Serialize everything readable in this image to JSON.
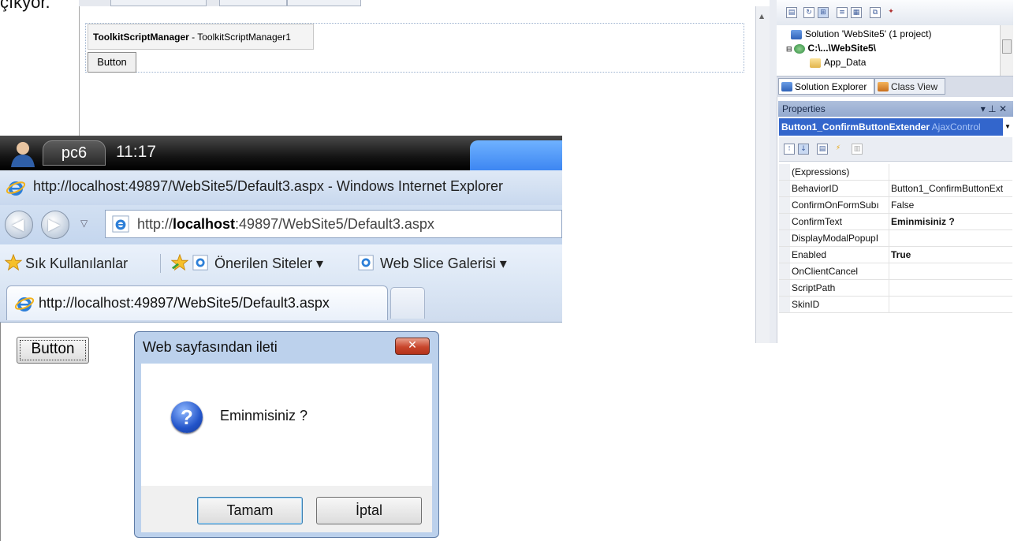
{
  "caption": "çıkyor.",
  "designer": {
    "toolkit_box_bold": "ToolkitScriptManager",
    "toolkit_box_rest": " - ToolkitScriptManager1",
    "button_label": "Button"
  },
  "solution_explorer": {
    "tree": [
      {
        "label": "Solution 'WebSite5' (1 project)"
      },
      {
        "label": "C:\\...\\WebSite5\\"
      },
      {
        "label": "App_Data"
      }
    ],
    "tabs": [
      {
        "label": "Solution Explorer"
      },
      {
        "label": "Class View"
      }
    ]
  },
  "properties": {
    "title": "Properties",
    "controls": "▾ ⊥ ✕",
    "selected_object": "Button1_ConfirmButtonExtender",
    "selected_type": "AjaxControl",
    "rows": [
      {
        "name": "(Expressions)",
        "value": "",
        "bold": false
      },
      {
        "name": "BehaviorID",
        "value": "Button1_ConfirmButtonExt",
        "bold": false
      },
      {
        "name": "ConfirmOnFormSubı",
        "value": "False",
        "bold": false
      },
      {
        "name": "ConfirmText",
        "value": "Eminmisiniz ?",
        "bold": true
      },
      {
        "name": "DisplayModalPopupI",
        "value": "",
        "bold": false
      },
      {
        "name": "Enabled",
        "value": "True",
        "bold": true
      },
      {
        "name": "OnClientCancel",
        "value": "",
        "bold": false
      },
      {
        "name": "ScriptPath",
        "value": "",
        "bold": false
      },
      {
        "name": "SkinID",
        "value": "",
        "bold": false
      }
    ]
  },
  "taskbar": {
    "user": "pc6",
    "clock": "11:17"
  },
  "ie": {
    "window_title": "http://localhost:49897/WebSite5/Default3.aspx - Windows Internet Explorer",
    "address_prefix": "http://",
    "address_host": "localhost",
    "address_rest": ":49897/WebSite5/Default3.aspx",
    "favorites": "Sık Kullanılanlar",
    "suggested_sites": "Önerilen Siteler ▾",
    "web_slice": "Web Slice Galerisi ▾",
    "tab_title": "http://localhost:49897/WebSite5/Default3.aspx",
    "page_button": "Button"
  },
  "dialog": {
    "title": "Web sayfasından ileti",
    "message": "Eminmisiniz ?",
    "ok": "Tamam",
    "cancel": "İptal",
    "close_glyph": "✕"
  },
  "colors": {
    "ie_accent": "#3d86f2",
    "vs_selection": "#3366cc",
    "dialog_frame": "#bcd1ec",
    "close_red": "#c8462c"
  }
}
